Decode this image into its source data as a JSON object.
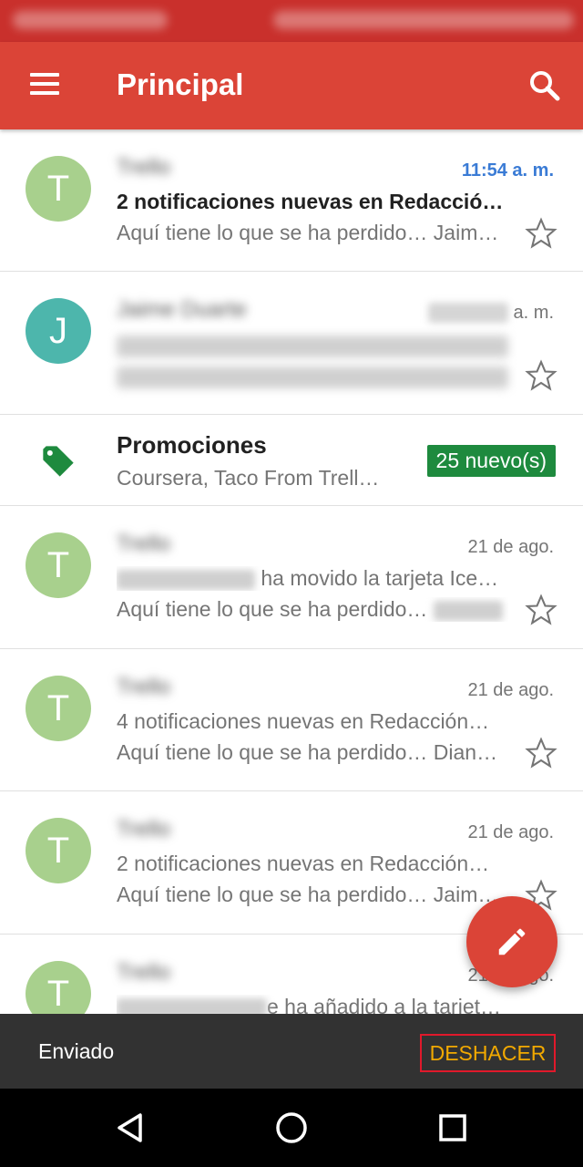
{
  "colors": {
    "app_bar": "#db4437",
    "status_bar": "#c9302c",
    "avatar_t": "#a8d08d",
    "avatar_j": "#4db6ac",
    "promo_badge": "#1e8a3e",
    "promo_icon": "#1e8a3e",
    "unread_time": "#3a7bd5",
    "snackbar": "#323232",
    "snackbar_action": "#f2a900",
    "fab": "#db4437"
  },
  "header": {
    "title": "Principal",
    "menu_icon": "menu-icon",
    "search_icon": "search-icon"
  },
  "emails": [
    {
      "avatar_letter": "T",
      "sender": "Trello",
      "time": "11:54 a. m.",
      "subject": "2 notificaciones nuevas en Redacció…",
      "preview": "Aquí tiene lo que se ha perdido… Jaime…",
      "unread": true
    },
    {
      "avatar_letter": "J",
      "sender": "Jaime Duarte",
      "time": "a. m.",
      "subject": "",
      "preview": ""
    }
  ],
  "promotions": {
    "title": "Promociones",
    "preview": "Coursera, Taco From Trell…",
    "badge": "25 nuevo(s)"
  },
  "emails_more": [
    {
      "avatar_letter": "T",
      "sender": "Trello",
      "time": "21 de ago.",
      "subject": "ha movido la tarjeta Ice…",
      "preview": "Aquí tiene lo que se ha perdido…"
    },
    {
      "avatar_letter": "T",
      "sender": "Trello",
      "time": "21 de ago.",
      "subject": "4 notificaciones nuevas en Redacción…",
      "preview": "Aquí tiene lo que se ha perdido… Diana…"
    },
    {
      "avatar_letter": "T",
      "sender": "Trello",
      "time": "21 de ago.",
      "subject": "2 notificaciones nuevas en Redacción…",
      "preview": "Aquí tiene lo que se ha perdido… Jaime…"
    },
    {
      "avatar_letter": "T",
      "sender": "Trello",
      "time": "21 de ago.",
      "subject": "e ha añadido a la tariet…",
      "preview": ""
    }
  ],
  "snackbar": {
    "message": "Enviado",
    "action": "DESHACER"
  },
  "fab": {
    "icon": "pencil-icon"
  },
  "nav": {
    "back_icon": "back-icon",
    "home_icon": "home-icon",
    "recents_icon": "recents-icon"
  }
}
